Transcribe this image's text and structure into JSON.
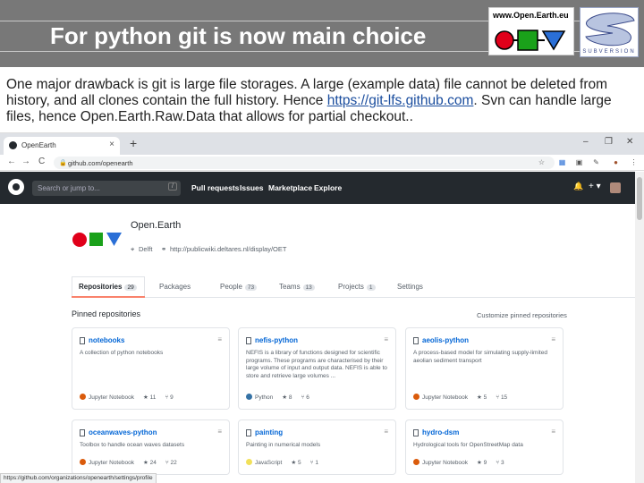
{
  "slide": {
    "title": "For python git is now main choice",
    "logo_openearth_url": "www.Open.Earth.eu",
    "logo_svn_text": "SUBVERSION",
    "intro_before_link": "One major drawback is git is large file storages. A large (example data) file cannot be deleted from history, and all clones contain the full history. Hence ",
    "intro_link": "https://git-lfs.github.com",
    "intro_after_link": ". Svn can handle large files, hence Open.Earth.Raw.Data that allows for partial checkout..",
    "colors": {
      "header_bg": "#787878",
      "oe_red": "#e0001a",
      "oe_green": "#1aa11a",
      "oe_blue": "#2a6fd6"
    }
  },
  "browser": {
    "tab_title": "OpenEarth",
    "tab_close": "×",
    "new_tab": "+",
    "window_controls": [
      "–",
      "❐",
      "✕"
    ],
    "nav_icons": [
      "back-icon",
      "forward-icon",
      "reload-icon"
    ],
    "nav_glyphs": [
      "←",
      "→",
      "C"
    ],
    "address": "github.com/openearth",
    "extension_icons": [
      "star-icon",
      "windows-icon",
      "gif-icon",
      "pencil-icon",
      "avatar-icon",
      "menu-icon"
    ],
    "extension_glyphs": [
      "☆",
      "▦",
      "▣",
      "✎",
      "●",
      "⋮"
    ],
    "status_url": "https://github.com/organizations/openearth/settings/profile"
  },
  "github": {
    "search_placeholder": "Search or jump to...",
    "search_key": "/",
    "nav": [
      "Pull requests",
      "Issues",
      "Marketplace",
      "Explore"
    ],
    "bell": "🔔",
    "plus": "+ ▾",
    "org_name": "Open.Earth",
    "org_location": "Delft",
    "org_url": "http://publicwiki.deltares.nl/display/OET",
    "tabs": [
      {
        "label": "Repositories",
        "count": "29"
      },
      {
        "label": "Packages",
        "count": ""
      },
      {
        "label": "People",
        "count": "73"
      },
      {
        "label": "Teams",
        "count": "13"
      },
      {
        "label": "Projects",
        "count": "1"
      },
      {
        "label": "Settings",
        "count": ""
      }
    ],
    "pinned_title": "Pinned repositories",
    "customize": "Customize pinned repositories",
    "repos": [
      {
        "name": "notebooks",
        "desc": "A collection of python notebooks",
        "lang": "Jupyter Notebook",
        "lang_color": "#DA5B0B",
        "stars": "11",
        "forks": "9"
      },
      {
        "name": "nefis-python",
        "desc": "NEFIS is a library of functions designed for scientific programs. These programs are characterised by their large volume of input and output data. NEFIS is able to store and retrieve large volumes ...",
        "lang": "Python",
        "lang_color": "#3572A5",
        "stars": "8",
        "forks": "6"
      },
      {
        "name": "aeolis-python",
        "desc": "A process-based model for simulating supply-limited aeolian sediment transport",
        "lang": "Jupyter Notebook",
        "lang_color": "#DA5B0B",
        "stars": "5",
        "forks": "15"
      },
      {
        "name": "oceanwaves-python",
        "desc": "Toolbox to handle ocean waves datasets",
        "lang": "Jupyter Notebook",
        "lang_color": "#DA5B0B",
        "stars": "24",
        "forks": "22"
      },
      {
        "name": "painting",
        "desc": "Painting in numerical models",
        "lang": "JavaScript",
        "lang_color": "#F1E05A",
        "stars": "5",
        "forks": "1"
      },
      {
        "name": "hydro-dsm",
        "desc": "Hydrological tools for OpenStreetMap data",
        "lang": "Jupyter Notebook",
        "lang_color": "#DA5B0B",
        "stars": "9",
        "forks": "3"
      }
    ]
  }
}
